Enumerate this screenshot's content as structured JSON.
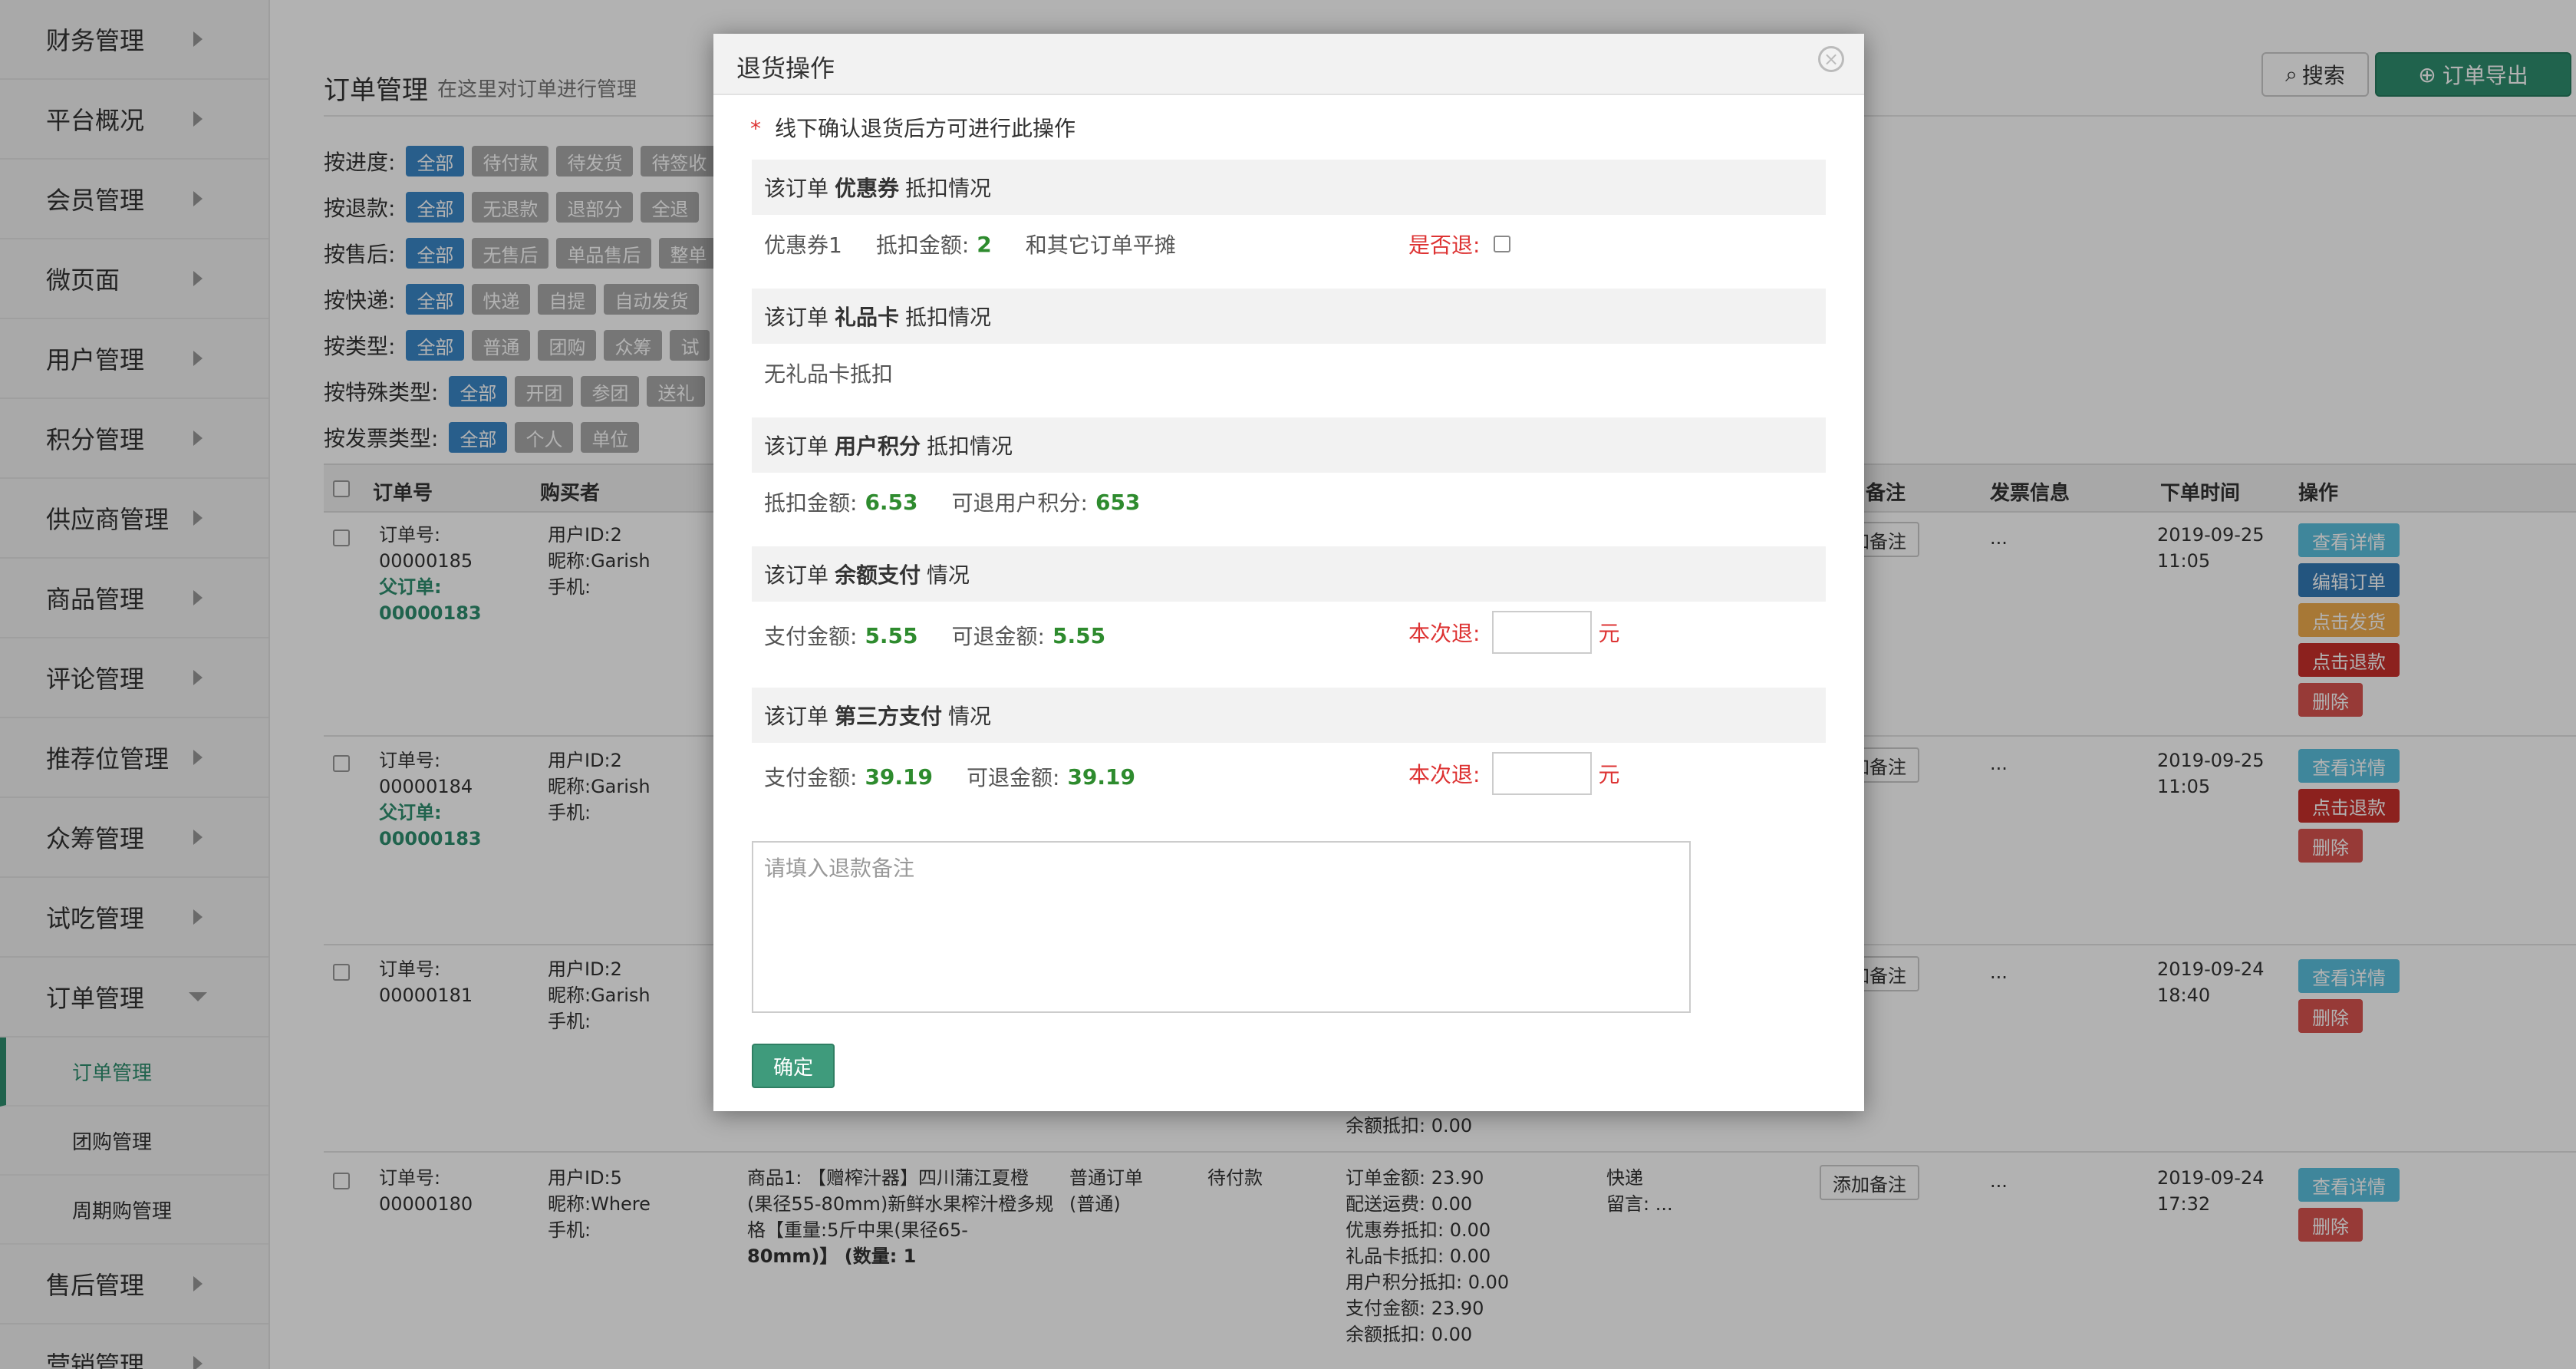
{
  "sidebar": {
    "items": [
      {
        "label": "财务管理"
      },
      {
        "label": "平台概况"
      },
      {
        "label": "会员管理"
      },
      {
        "label": "微页面"
      },
      {
        "label": "用户管理"
      },
      {
        "label": "积分管理"
      },
      {
        "label": "供应商管理"
      },
      {
        "label": "商品管理"
      },
      {
        "label": "评论管理"
      },
      {
        "label": "推荐位管理"
      },
      {
        "label": "众筹管理"
      },
      {
        "label": "试吃管理"
      },
      {
        "label": "订单管理"
      }
    ],
    "sub_items": [
      {
        "label": "订单管理"
      },
      {
        "label": "团购管理"
      },
      {
        "label": "周期购管理"
      }
    ],
    "after_items": [
      {
        "label": "售后管理"
      },
      {
        "label": "营销管理"
      }
    ]
  },
  "page": {
    "title": "订单管理",
    "subtitle": "在这里对订单进行管理",
    "search_label": "搜索",
    "export_label": "订单导出"
  },
  "filters": [
    {
      "label": "按进度:",
      "tags": [
        "全部",
        "待付款",
        "待发货",
        "待签收"
      ]
    },
    {
      "label": "按退款:",
      "tags": [
        "全部",
        "无退款",
        "退部分",
        "全退"
      ]
    },
    {
      "label": "按售后:",
      "tags": [
        "全部",
        "无售后",
        "单品售后",
        "整单"
      ]
    },
    {
      "label": "按快递:",
      "tags": [
        "全部",
        "快递",
        "自提",
        "自动发货"
      ]
    },
    {
      "label": "按类型:",
      "tags": [
        "全部",
        "普通",
        "团购",
        "众筹",
        "试"
      ]
    },
    {
      "label": "按特殊类型:",
      "tags": [
        "全部",
        "开团",
        "参团",
        "送礼"
      ]
    },
    {
      "label": "按发票类型:",
      "tags": [
        "全部",
        "个人",
        "单位"
      ]
    }
  ],
  "table": {
    "headers": {
      "order_no": "订单号",
      "buyer": "购买者",
      "note": "备注",
      "invoice": "发票信息",
      "time": "下单时间",
      "ops": "操作"
    },
    "rows": [
      {
        "order_label": "订单号:",
        "order_no": "00000185",
        "parent_label": "父订单:",
        "parent_no": "00000183",
        "uid": "用户ID:2",
        "nick": "昵称:Garish",
        "phone": "手机:",
        "note_btn": "添加备注",
        "invoice": "...",
        "date": "2019-09-25",
        "time": "11:05",
        "ops": [
          "查看详情",
          "编辑订单",
          "点击发货",
          "点击退款",
          "删除"
        ]
      },
      {
        "order_label": "订单号:",
        "order_no": "00000184",
        "parent_label": "父订单:",
        "parent_no": "00000183",
        "uid": "用户ID:2",
        "nick": "昵称:Garish",
        "phone": "手机:",
        "note_btn": "添加备注",
        "invoice": "...",
        "date": "2019-09-25",
        "time": "11:05",
        "ops": [
          "查看详情",
          "点击退款",
          "删除"
        ]
      },
      {
        "order_label": "订单号:",
        "order_no": "00000181",
        "uid": "用户ID:2",
        "nick": "昵称:Garish",
        "phone": "手机:",
        "note_btn": "添加备注",
        "invoice": "...",
        "date": "2019-09-24",
        "time": "18:40",
        "ops": [
          "查看详情",
          "删除"
        ],
        "balance_deduct": "余额抵扣: 0.00"
      },
      {
        "order_label": "订单号:",
        "order_no": "00000180",
        "uid": "用户ID:5",
        "nick": "昵称:Where",
        "phone": "手机:",
        "product": [
          "商品1: 【赠榨汁器】四川蒲江夏橙",
          "(果径55-80mm)新鲜水果榨汁橙多规",
          "格【重量:5斤中果(果径65-",
          "80mm)】 (数量: 1"
        ],
        "order_type": [
          "普通订单",
          "(普通)"
        ],
        "status": "待付款",
        "amounts": [
          "订单金额: 23.90",
          "配送运费: 0.00",
          "优惠券抵扣: 0.00",
          "礼品卡抵扣: 0.00",
          "用户积分抵扣: 0.00",
          "支付金额: 23.90",
          "余额抵扣: 0.00"
        ],
        "delivery": "快递",
        "message": "留言: ...",
        "note_btn": "添加备注",
        "invoice": "...",
        "date": "2019-09-24",
        "time": "17:32",
        "ops": [
          "查看详情",
          "删除"
        ]
      }
    ]
  },
  "modal": {
    "title": "退货操作",
    "notice_star": "*",
    "notice": "线下确认退货后方可进行此操作",
    "coupon": {
      "pre": "该订单",
      "key": "优惠券",
      "post": "抵扣情况",
      "name": "优惠券1",
      "deduct_label": "抵扣金额:",
      "deduct_value": "2",
      "share_text": "和其它订单平摊",
      "refund_q": "是否退:"
    },
    "giftcard": {
      "pre": "该订单",
      "key": "礼品卡",
      "post": "抵扣情况",
      "text": "无礼品卡抵扣"
    },
    "points": {
      "pre": "该订单",
      "key": "用户积分",
      "post": "抵扣情况",
      "deduct_label": "抵扣金额:",
      "deduct_value": "6.53",
      "refundable_label": "可退用户积分:",
      "refundable_value": "653"
    },
    "balance": {
      "pre": "该订单",
      "key": "余额支付",
      "post": "情况",
      "pay_label": "支付金额:",
      "pay_value": "5.55",
      "refundable_label": "可退金额:",
      "refundable_value": "5.55",
      "this_refund": "本次退:",
      "unit": "元"
    },
    "thirdparty": {
      "pre": "该订单",
      "key": "第三方支付",
      "post": "情况",
      "pay_label": "支付金额:",
      "pay_value": "39.19",
      "refundable_label": "可退金额:",
      "refundable_value": "39.19",
      "this_refund": "本次退:",
      "unit": "元"
    },
    "remark_placeholder": "请填入退款备注",
    "confirm_label": "确定"
  }
}
